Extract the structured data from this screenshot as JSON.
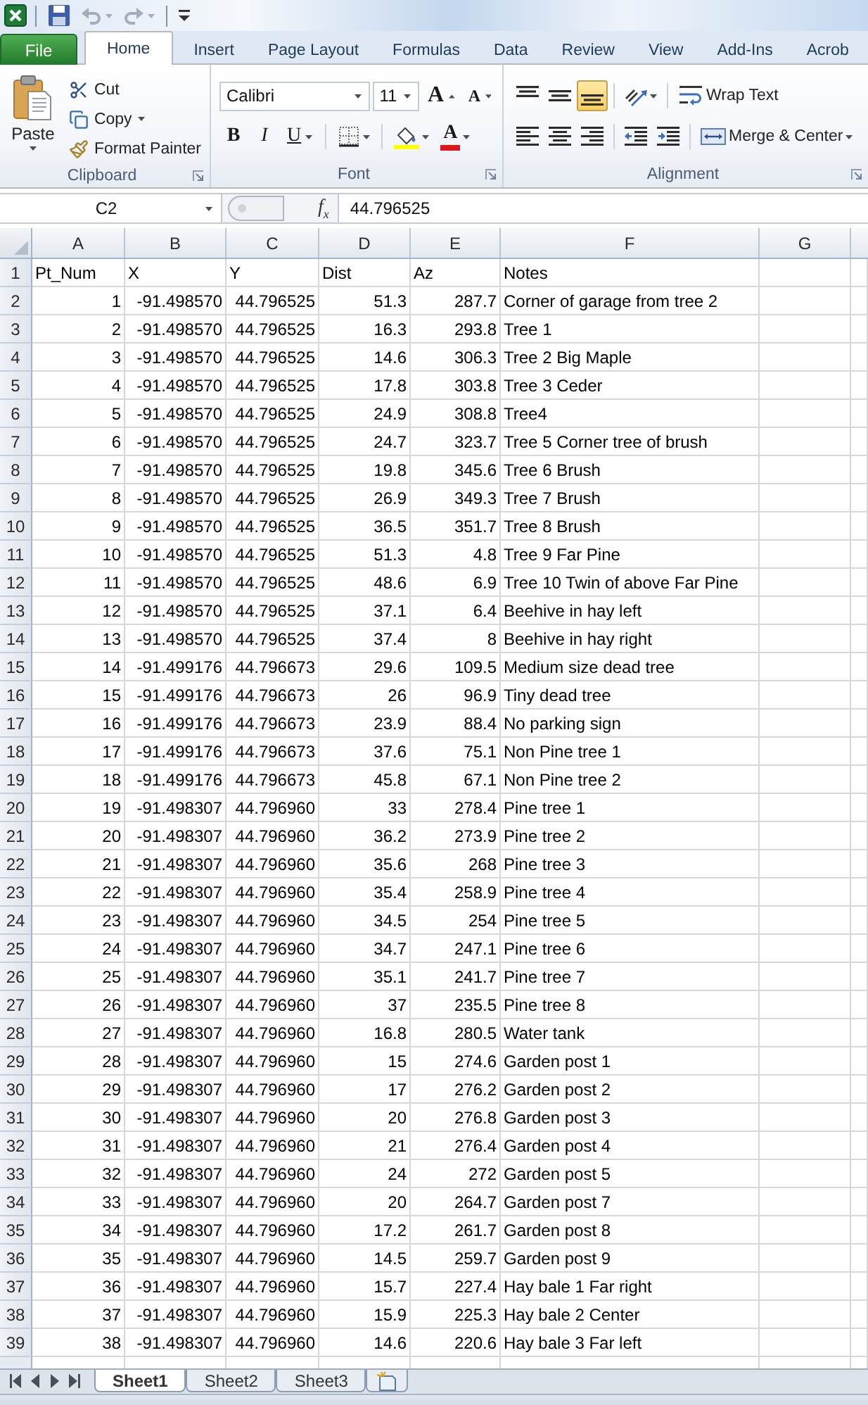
{
  "quick_access": [
    {
      "kind": "save",
      "disabled": false
    },
    {
      "kind": "undo",
      "disabled": true
    },
    {
      "kind": "redo",
      "disabled": true
    },
    {
      "kind": "customize",
      "disabled": false
    }
  ],
  "tabs": [
    {
      "label": "File",
      "kind": "file",
      "selected": false
    },
    {
      "label": "Home",
      "kind": "tab",
      "selected": true
    },
    {
      "label": "Insert",
      "kind": "tab",
      "selected": false
    },
    {
      "label": "Page Layout",
      "kind": "tab",
      "selected": false
    },
    {
      "label": "Formulas",
      "kind": "tab",
      "selected": false
    },
    {
      "label": "Data",
      "kind": "tab",
      "selected": false
    },
    {
      "label": "Review",
      "kind": "tab",
      "selected": false
    },
    {
      "label": "View",
      "kind": "tab",
      "selected": false
    },
    {
      "label": "Add-Ins",
      "kind": "tab",
      "selected": false
    },
    {
      "label": "Acrob",
      "kind": "tab",
      "selected": false
    }
  ],
  "ribbon": {
    "clipboard": {
      "label": "Clipboard",
      "paste": "Paste",
      "commands": [
        {
          "kind": "cut",
          "label": "Cut",
          "has_menu": false
        },
        {
          "kind": "copy",
          "label": "Copy",
          "has_menu": true
        },
        {
          "kind": "format_painter",
          "label": "Format Painter",
          "has_menu": false
        }
      ]
    },
    "font": {
      "label": "Font",
      "font_name": "Calibri",
      "font_size": "11",
      "size_buttons": [
        {
          "kind": "grow",
          "glyph": "A"
        },
        {
          "kind": "shrink",
          "glyph": "A"
        }
      ],
      "style_buttons": [
        {
          "kind": "bold",
          "glyph": "B",
          "has_menu": false
        },
        {
          "kind": "italic",
          "glyph": "I",
          "has_menu": false
        },
        {
          "kind": "underline",
          "glyph": "U",
          "has_menu": true
        }
      ],
      "font_color": {
        "glyph": "A"
      }
    },
    "alignment": {
      "label": "Alignment",
      "vertical": [
        {
          "kind": "top",
          "selected": false
        },
        {
          "kind": "middle",
          "selected": false
        },
        {
          "kind": "bottom",
          "selected": true
        }
      ],
      "horizontal": [
        {
          "kind": "left",
          "selected": false
        },
        {
          "kind": "center",
          "selected": false
        },
        {
          "kind": "right",
          "selected": false
        }
      ],
      "wrap_text": "Wrap Text",
      "merge_center": "Merge & Center"
    }
  },
  "formula_bar": {
    "name_box": "C2",
    "function_label": "f$_{x}$",
    "value": "44.796525"
  },
  "sheet": {
    "columns": [
      "A",
      "B",
      "C",
      "D",
      "E",
      "F",
      "G"
    ],
    "rows": [
      {
        "number": "1",
        "cells": [
          "Pt_Num",
          "X",
          "Y",
          "Dist",
          "Az",
          "Notes"
        ]
      },
      {
        "number": "2",
        "cells": [
          "1",
          "-91.498570",
          "44.796525",
          "51.3",
          "287.7",
          "Corner of garage from tree 2"
        ]
      },
      {
        "number": "3",
        "cells": [
          "2",
          "-91.498570",
          "44.796525",
          "16.3",
          "293.8",
          "Tree 1"
        ]
      },
      {
        "number": "4",
        "cells": [
          "3",
          "-91.498570",
          "44.796525",
          "14.6",
          "306.3",
          "Tree 2 Big Maple"
        ]
      },
      {
        "number": "5",
        "cells": [
          "4",
          "-91.498570",
          "44.796525",
          "17.8",
          "303.8",
          "Tree 3 Ceder"
        ]
      },
      {
        "number": "6",
        "cells": [
          "5",
          "-91.498570",
          "44.796525",
          "24.9",
          "308.8",
          "Tree4"
        ]
      },
      {
        "number": "7",
        "cells": [
          "6",
          "-91.498570",
          "44.796525",
          "24.7",
          "323.7",
          "Tree 5 Corner tree of brush"
        ]
      },
      {
        "number": "8",
        "cells": [
          "7",
          "-91.498570",
          "44.796525",
          "19.8",
          "345.6",
          "Tree 6 Brush"
        ]
      },
      {
        "number": "9",
        "cells": [
          "8",
          "-91.498570",
          "44.796525",
          "26.9",
          "349.3",
          "Tree 7 Brush"
        ]
      },
      {
        "number": "10",
        "cells": [
          "9",
          "-91.498570",
          "44.796525",
          "36.5",
          "351.7",
          "Tree 8 Brush"
        ]
      },
      {
        "number": "11",
        "cells": [
          "10",
          "-91.498570",
          "44.796525",
          "51.3",
          "4.8",
          "Tree 9 Far Pine"
        ]
      },
      {
        "number": "12",
        "cells": [
          "11",
          "-91.498570",
          "44.796525",
          "48.6",
          "6.9",
          "Tree 10 Twin of above Far Pine"
        ]
      },
      {
        "number": "13",
        "cells": [
          "12",
          "-91.498570",
          "44.796525",
          "37.1",
          "6.4",
          "Beehive in hay left"
        ]
      },
      {
        "number": "14",
        "cells": [
          "13",
          "-91.498570",
          "44.796525",
          "37.4",
          "8",
          "Beehive in hay right"
        ]
      },
      {
        "number": "15",
        "cells": [
          "14",
          "-91.499176",
          "44.796673",
          "29.6",
          "109.5",
          "Medium size dead tree"
        ]
      },
      {
        "number": "16",
        "cells": [
          "15",
          "-91.499176",
          "44.796673",
          "26",
          "96.9",
          "Tiny dead tree"
        ]
      },
      {
        "number": "17",
        "cells": [
          "16",
          "-91.499176",
          "44.796673",
          "23.9",
          "88.4",
          "No parking sign"
        ]
      },
      {
        "number": "18",
        "cells": [
          "17",
          "-91.499176",
          "44.796673",
          "37.6",
          "75.1",
          "Non Pine tree 1"
        ]
      },
      {
        "number": "19",
        "cells": [
          "18",
          "-91.499176",
          "44.796673",
          "45.8",
          "67.1",
          "Non Pine tree 2"
        ]
      },
      {
        "number": "20",
        "cells": [
          "19",
          "-91.498307",
          "44.796960",
          "33",
          "278.4",
          "Pine tree 1"
        ]
      },
      {
        "number": "21",
        "cells": [
          "20",
          "-91.498307",
          "44.796960",
          "36.2",
          "273.9",
          "Pine tree 2"
        ]
      },
      {
        "number": "22",
        "cells": [
          "21",
          "-91.498307",
          "44.796960",
          "35.6",
          "268",
          "Pine tree 3"
        ]
      },
      {
        "number": "23",
        "cells": [
          "22",
          "-91.498307",
          "44.796960",
          "35.4",
          "258.9",
          "Pine tree 4"
        ]
      },
      {
        "number": "24",
        "cells": [
          "23",
          "-91.498307",
          "44.796960",
          "34.5",
          "254",
          "Pine tree 5"
        ]
      },
      {
        "number": "25",
        "cells": [
          "24",
          "-91.498307",
          "44.796960",
          "34.7",
          "247.1",
          "Pine tree 6"
        ]
      },
      {
        "number": "26",
        "cells": [
          "25",
          "-91.498307",
          "44.796960",
          "35.1",
          "241.7",
          "Pine tree 7"
        ]
      },
      {
        "number": "27",
        "cells": [
          "26",
          "-91.498307",
          "44.796960",
          "37",
          "235.5",
          "Pine tree 8"
        ]
      },
      {
        "number": "28",
        "cells": [
          "27",
          "-91.498307",
          "44.796960",
          "16.8",
          "280.5",
          "Water tank"
        ]
      },
      {
        "number": "29",
        "cells": [
          "28",
          "-91.498307",
          "44.796960",
          "15",
          "274.6",
          "Garden post 1"
        ]
      },
      {
        "number": "30",
        "cells": [
          "29",
          "-91.498307",
          "44.796960",
          "17",
          "276.2",
          "Garden post 2"
        ]
      },
      {
        "number": "31",
        "cells": [
          "30",
          "-91.498307",
          "44.796960",
          "20",
          "276.8",
          "Garden post 3"
        ]
      },
      {
        "number": "32",
        "cells": [
          "31",
          "-91.498307",
          "44.796960",
          "21",
          "276.4",
          "Garden post 4"
        ]
      },
      {
        "number": "33",
        "cells": [
          "32",
          "-91.498307",
          "44.796960",
          "24",
          "272",
          "Garden post 5"
        ]
      },
      {
        "number": "34",
        "cells": [
          "33",
          "-91.498307",
          "44.796960",
          "20",
          "264.7",
          "Garden post 7"
        ]
      },
      {
        "number": "35",
        "cells": [
          "34",
          "-91.498307",
          "44.796960",
          "17.2",
          "261.7",
          "Garden post 8"
        ]
      },
      {
        "number": "36",
        "cells": [
          "35",
          "-91.498307",
          "44.796960",
          "14.5",
          "259.7",
          "Garden post 9"
        ]
      },
      {
        "number": "37",
        "cells": [
          "36",
          "-91.498307",
          "44.796960",
          "15.7",
          "227.4",
          "Hay bale 1 Far right"
        ]
      },
      {
        "number": "38",
        "cells": [
          "37",
          "-91.498307",
          "44.796960",
          "15.9",
          "225.3",
          "Hay bale 2 Center"
        ]
      },
      {
        "number": "39",
        "cells": [
          "38",
          "-91.498307",
          "44.796960",
          "14.6",
          "220.6",
          "Hay bale 3 Far left"
        ]
      }
    ]
  },
  "sheet_tabs": [
    {
      "label": "Sheet1",
      "selected": true
    },
    {
      "label": "Sheet2",
      "selected": false
    },
    {
      "label": "Sheet3",
      "selected": false
    }
  ]
}
